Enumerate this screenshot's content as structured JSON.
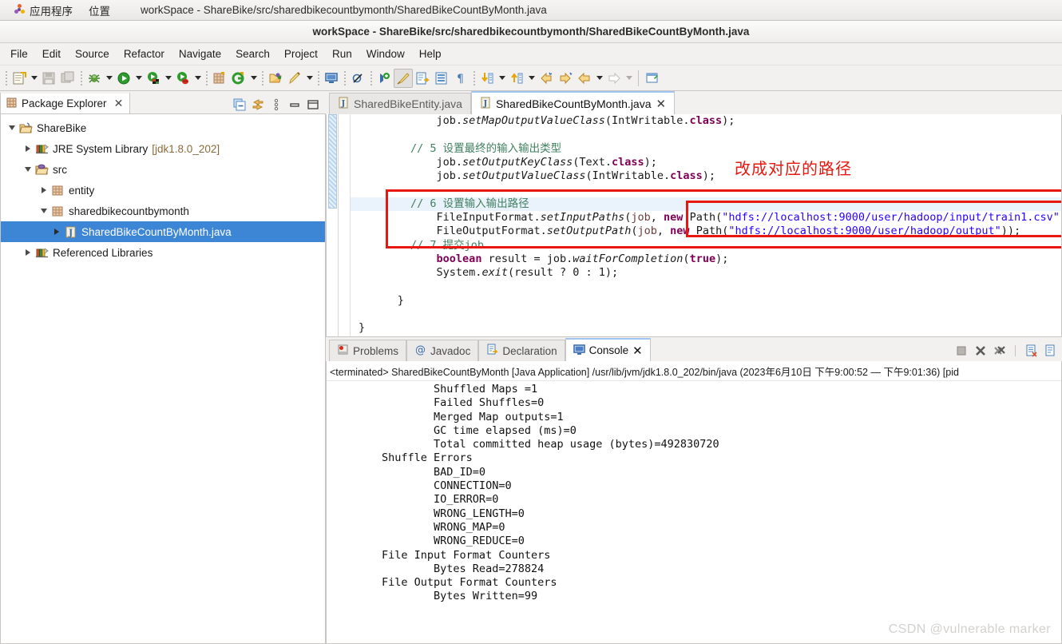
{
  "desktop": {
    "applications_label": "应用程序",
    "places_label": "位置",
    "window_title": "workSpace - ShareBike/src/sharedbikecountbymonth/SharedBikeCountByMonth.java"
  },
  "window": {
    "title": "workSpace - ShareBike/src/sharedbikecountbymonth/SharedBikeCountByMonth.java"
  },
  "menubar": {
    "items": [
      {
        "label": "File"
      },
      {
        "label": "Edit"
      },
      {
        "label": "Source"
      },
      {
        "label": "Refactor"
      },
      {
        "label": "Navigate"
      },
      {
        "label": "Search"
      },
      {
        "label": "Project"
      },
      {
        "label": "Run"
      },
      {
        "label": "Window"
      },
      {
        "label": "Help"
      }
    ]
  },
  "toolbar": {
    "icons": [
      "new-wizard-icon",
      "save-icon",
      "save-all-icon",
      "debug-icon",
      "run-icon",
      "run-external-tools-icon",
      "run-coverage-icon",
      "new-java-project-icon",
      "new-annotation-icon",
      "open-type-icon",
      "search-icon",
      "toggle-mark-occurrences-icon",
      "open-task-icon",
      "skip-all-breakpoints-icon",
      "next-annotation-icon",
      "previous-annotation-icon",
      "last-edit-location-icon",
      "back-icon",
      "forward-icon",
      "pin-editor-icon"
    ]
  },
  "package_explorer": {
    "tab_label": "Package Explorer",
    "close_glyph": "✕",
    "view_icons": [
      "collapse-all-icon",
      "link-with-editor-icon",
      "view-menu-icon",
      "minimize-icon",
      "maximize-icon"
    ],
    "tree": [
      {
        "label": "ShareBike",
        "indent": 0,
        "twisty": "down",
        "icon": "java-project-icon",
        "selected": false
      },
      {
        "label": "JRE System Library",
        "suffix": "[jdk1.8.0_202]",
        "indent": 1,
        "twisty": "right",
        "icon": "library-icon",
        "selected": false
      },
      {
        "label": "src",
        "indent": 1,
        "twisty": "down",
        "icon": "source-folder-icon",
        "selected": false
      },
      {
        "label": "entity",
        "indent": 2,
        "twisty": "right",
        "icon": "package-icon",
        "selected": false
      },
      {
        "label": "sharedbikecountbymonth",
        "indent": 2,
        "twisty": "down",
        "icon": "package-icon",
        "selected": false
      },
      {
        "label": "SharedBikeCountByMonth.java",
        "indent": 3,
        "twisty": "right",
        "icon": "java-file-icon",
        "selected": true
      },
      {
        "label": "Referenced Libraries",
        "indent": 1,
        "twisty": "right",
        "icon": "library-icon",
        "selected": false
      }
    ]
  },
  "editor": {
    "tabs": [
      {
        "label": "SharedBikeEntity.java",
        "active": false,
        "closable": false
      },
      {
        "label": "SharedBikeCountByMonth.java",
        "active": true,
        "closable": true,
        "close_glyph": "✕"
      }
    ],
    "annotation_note": "改成对应的路径",
    "lines": [
      {
        "id": "l1",
        "highlight": false,
        "segments": [
          {
            "t": "            job.",
            "c": "stat"
          },
          {
            "t": "setMapOutputValueClass",
            "c": "mth"
          },
          {
            "t": "(IntWritable.",
            "c": "stat"
          },
          {
            "t": "class",
            "c": "kw"
          },
          {
            "t": ");",
            "c": "stat"
          }
        ]
      },
      {
        "id": "l2",
        "highlight": false,
        "segments": [
          {
            "t": "",
            "c": "stat"
          }
        ]
      },
      {
        "id": "l3",
        "highlight": false,
        "segments": [
          {
            "t": "        // 5 设置最终的输入输出类型",
            "c": "cm"
          }
        ]
      },
      {
        "id": "l4",
        "highlight": false,
        "segments": [
          {
            "t": "            job.",
            "c": "stat"
          },
          {
            "t": "setOutputKeyClass",
            "c": "mth"
          },
          {
            "t": "(Text.",
            "c": "stat"
          },
          {
            "t": "class",
            "c": "kw"
          },
          {
            "t": ");",
            "c": "stat"
          }
        ]
      },
      {
        "id": "l5",
        "highlight": false,
        "segments": [
          {
            "t": "            job.",
            "c": "stat"
          },
          {
            "t": "setOutputValueClass",
            "c": "mth"
          },
          {
            "t": "(IntWritable.",
            "c": "stat"
          },
          {
            "t": "class",
            "c": "kw"
          },
          {
            "t": ");",
            "c": "stat"
          }
        ]
      },
      {
        "id": "l6",
        "highlight": false,
        "segments": [
          {
            "t": "",
            "c": "stat"
          }
        ]
      },
      {
        "id": "l7",
        "highlight": true,
        "segments": [
          {
            "t": "        // 6 设置输入输出路径",
            "c": "cm"
          }
        ]
      },
      {
        "id": "l8",
        "highlight": false,
        "segments": [
          {
            "t": "            FileInputFormat.",
            "c": "stat"
          },
          {
            "t": "setInputPaths",
            "c": "mth"
          },
          {
            "t": "(",
            "c": "stat"
          },
          {
            "t": "job",
            "c": "param"
          },
          {
            "t": ", ",
            "c": "stat"
          },
          {
            "t": "new",
            "c": "kw"
          },
          {
            "t": " Path(",
            "c": "stat"
          },
          {
            "t": "\"hdfs://localhost:9000/user/hadoop/input/train1.csv\"",
            "c": "str"
          },
          {
            "t": "));",
            "c": "stat"
          }
        ]
      },
      {
        "id": "l9",
        "highlight": false,
        "segments": [
          {
            "t": "            FileOutputFormat.",
            "c": "stat"
          },
          {
            "t": "setOutputPath",
            "c": "mth"
          },
          {
            "t": "(",
            "c": "stat"
          },
          {
            "t": "job",
            "c": "param"
          },
          {
            "t": ", ",
            "c": "stat"
          },
          {
            "t": "new",
            "c": "kw"
          },
          {
            "t": " Path(",
            "c": "stat"
          },
          {
            "t": "\"hdfs://localhost:9000/user/hadoop/output\"",
            "c": "str"
          },
          {
            "t": "));",
            "c": "stat"
          }
        ]
      },
      {
        "id": "l10",
        "highlight": false,
        "segments": [
          {
            "t": "        // 7 提交job",
            "c": "cm"
          }
        ]
      },
      {
        "id": "l11",
        "highlight": false,
        "segments": [
          {
            "t": "            ",
            "c": "stat"
          },
          {
            "t": "boolean",
            "c": "kw"
          },
          {
            "t": " result = job.",
            "c": "stat"
          },
          {
            "t": "waitForCompletion",
            "c": "mth"
          },
          {
            "t": "(",
            "c": "stat"
          },
          {
            "t": "true",
            "c": "kw"
          },
          {
            "t": ");",
            "c": "stat"
          }
        ]
      },
      {
        "id": "l12",
        "highlight": false,
        "segments": [
          {
            "t": "            System.",
            "c": "stat"
          },
          {
            "t": "exit",
            "c": "mth"
          },
          {
            "t": "(result ? 0 : 1);",
            "c": "stat"
          }
        ]
      },
      {
        "id": "l13",
        "highlight": false,
        "segments": [
          {
            "t": "",
            "c": "stat"
          }
        ]
      },
      {
        "id": "l14",
        "highlight": false,
        "segments": [
          {
            "t": "      }",
            "c": "stat"
          }
        ]
      },
      {
        "id": "l15",
        "highlight": false,
        "segments": [
          {
            "t": "",
            "c": "stat"
          }
        ]
      },
      {
        "id": "l16",
        "highlight": false,
        "segments": [
          {
            "t": "}",
            "c": "stat"
          }
        ]
      }
    ]
  },
  "console_panel": {
    "tabs": [
      {
        "label": "Problems",
        "icon": "problems-icon",
        "active": false
      },
      {
        "label": "Javadoc",
        "icon": "javadoc-icon",
        "active": false
      },
      {
        "label": "Declaration",
        "icon": "declaration-icon",
        "active": false
      },
      {
        "label": "Console",
        "icon": "console-icon",
        "active": true,
        "close_glyph": "✕"
      }
    ],
    "tools": [
      "terminate-icon",
      "remove-launch-icon",
      "remove-all-terminated-icon",
      "clear-console-icon",
      "scroll-lock-icon"
    ],
    "header": "<terminated> SharedBikeCountByMonth [Java Application] /usr/lib/jvm/jdk1.8.0_202/bin/java  (2023年6月10日 下午9:00:52 — 下午9:01:36) [pid",
    "output": "                Shuffled Maps =1\n                Failed Shuffles=0\n                Merged Map outputs=1\n                GC time elapsed (ms)=0\n                Total committed heap usage (bytes)=492830720\n        Shuffle Errors\n                BAD_ID=0\n                CONNECTION=0\n                IO_ERROR=0\n                WRONG_LENGTH=0\n                WRONG_MAP=0\n                WRONG_REDUCE=0\n        File Input Format Counters \n                Bytes Read=278824\n        File Output Format Counters \n                Bytes Written=99"
  },
  "watermark": {
    "text": "CSDN @vulnerable marker"
  },
  "colors": {
    "selection_blue": "#3d86d6",
    "annotation_red": "#e8170f",
    "string_blue": "#2a00ff",
    "keyword_purple": "#7f0055",
    "comment_green": "#3f7f5f",
    "highlight_line": "#eaf2fb"
  }
}
